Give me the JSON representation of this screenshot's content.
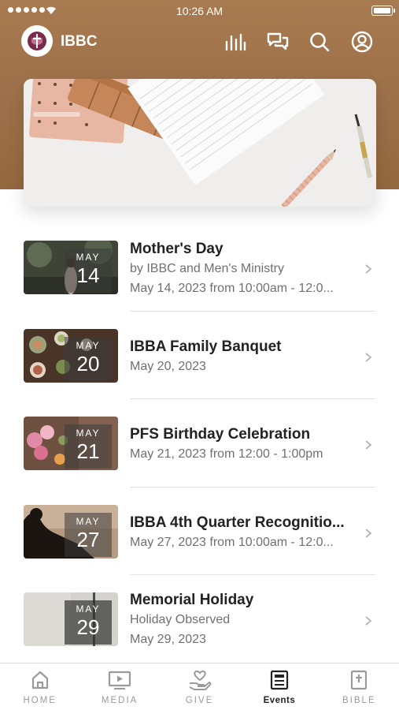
{
  "status_bar": {
    "time": "10:26 AM"
  },
  "header": {
    "title": "IBBC",
    "icons": [
      "logo",
      "chart-bars-icon",
      "chat-icon",
      "search-icon",
      "profile-icon"
    ]
  },
  "hero": {
    "image": "desk-notebook-pencils-photo"
  },
  "events": [
    {
      "month": "MAY",
      "day": "14",
      "title": "Mother's Day",
      "lines": [
        "by IBBC and Men's Ministry",
        "May 14, 2023 from 10:00am - 12:0..."
      ],
      "thumb": "garden-photo"
    },
    {
      "month": "MAY",
      "day": "20",
      "title": "IBBA Family Banquet",
      "lines": [
        "May 20, 2023"
      ],
      "thumb": "food-table-photo"
    },
    {
      "month": "MAY",
      "day": "21",
      "title": "PFS Birthday Celebration",
      "lines": [
        "May 21, 2023 from 12:00 - 1:00pm"
      ],
      "thumb": "flowers-photo"
    },
    {
      "month": "MAY",
      "day": "27",
      "title": "IBBA 4th Quarter Recognitio...",
      "lines": [
        "May 27, 2023 from 10:00am - 12:0..."
      ],
      "thumb": "silhouette-reading-photo"
    },
    {
      "month": "MAY",
      "day": "29",
      "title": "Memorial Holiday",
      "lines": [
        "Holiday Observed",
        "May 29, 2023"
      ],
      "thumb": "wall-shadow-photo"
    }
  ],
  "tabs": [
    {
      "label": "HOME",
      "icon": "home-icon",
      "active": false
    },
    {
      "label": "MEDIA",
      "icon": "media-icon",
      "active": false
    },
    {
      "label": "GIVE",
      "icon": "give-icon",
      "active": false
    },
    {
      "label": "Events",
      "icon": "events-icon",
      "active": true
    },
    {
      "label": "BIBLE",
      "icon": "bible-icon",
      "active": false
    }
  ],
  "colors": {
    "header_brown": "#a07349",
    "text_dark": "#222222",
    "text_muted": "#707070",
    "tab_inactive": "#9a9a9a"
  }
}
